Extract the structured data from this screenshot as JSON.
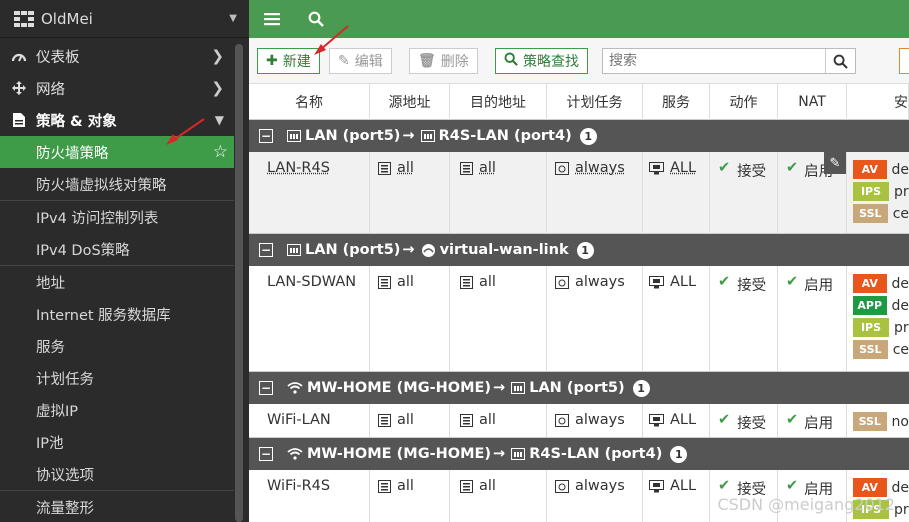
{
  "sidebar": {
    "title": "OldMei",
    "items": [
      {
        "label": "仪表板",
        "icon": "dashboard-icon"
      },
      {
        "label": "网络",
        "icon": "network-icon"
      },
      {
        "label": "策略 & 对象",
        "icon": "policy-icon"
      }
    ],
    "sub_items": [
      {
        "label": "防火墙策略",
        "active": true
      },
      {
        "label": "防火墙虚拟线对策略"
      },
      {
        "label": "IPv4 访问控制列表"
      },
      {
        "label": "IPv4 DoS策略"
      },
      {
        "label": "地址"
      },
      {
        "label": "Internet 服务数据库"
      },
      {
        "label": "服务"
      },
      {
        "label": "计划任务"
      },
      {
        "label": "虚拟IP"
      },
      {
        "label": "IP池"
      },
      {
        "label": "协议选项"
      },
      {
        "label": "流量整形"
      }
    ]
  },
  "toolbar": {
    "new_label": "新建",
    "edit_label": "编辑",
    "delete_label": "删除",
    "policy_lookup_label": "策略查找",
    "search_placeholder": "搜索"
  },
  "table": {
    "columns": [
      "名称",
      "源地址",
      "目的地址",
      "计划任务",
      "服务",
      "动作",
      "NAT",
      "安"
    ],
    "groups": [
      {
        "from": "LAN (port5)",
        "to": "R4S-LAN (port4)",
        "count": "1",
        "rows": [
          {
            "name": "LAN-R4S",
            "src": "all",
            "dst": "all",
            "schedule": "always",
            "service": "ALL",
            "action": "接受",
            "nat": "启用",
            "profiles": [
              {
                "tag": "AV",
                "text": "de"
              },
              {
                "tag": "IPS",
                "text": "pr"
              },
              {
                "tag": "SSL",
                "text": "ce"
              }
            ]
          }
        ]
      },
      {
        "from": "LAN (port5)",
        "to": "virtual-wan-link",
        "count": "1",
        "rows": [
          {
            "name": "LAN-SDWAN",
            "src": "all",
            "dst": "all",
            "schedule": "always",
            "service": "ALL",
            "action": "接受",
            "nat": "启用",
            "profiles": [
              {
                "tag": "AV",
                "text": "de"
              },
              {
                "tag": "APP",
                "text": "de"
              },
              {
                "tag": "IPS",
                "text": "pr"
              },
              {
                "tag": "SSL",
                "text": "ce"
              }
            ]
          }
        ]
      },
      {
        "from": "MW-HOME (MG-HOME)",
        "to": "LAN (port5)",
        "count": "1",
        "rows": [
          {
            "name": "WiFi-LAN",
            "src": "all",
            "dst": "all",
            "schedule": "always",
            "service": "ALL",
            "action": "接受",
            "nat": "启用",
            "profiles": [
              {
                "tag": "SSL",
                "text": "no"
              }
            ]
          }
        ]
      },
      {
        "from": "MW-HOME (MG-HOME)",
        "to": "R4S-LAN (port4)",
        "count": "1",
        "rows": [
          {
            "name": "WiFi-R4S",
            "src": "all",
            "dst": "all",
            "schedule": "always",
            "service": "ALL",
            "action": "接受",
            "nat": "启用",
            "profiles": [
              {
                "tag": "AV",
                "text": "de"
              },
              {
                "tag": "IPS",
                "text": "pr"
              }
            ]
          }
        ]
      }
    ]
  },
  "watermark": "CSDN @meigang2012",
  "colors": {
    "accent": "#4a9a52",
    "active": "#3e9b47",
    "sidebar_bg": "#2b2b2b",
    "group_bg": "#555555"
  }
}
